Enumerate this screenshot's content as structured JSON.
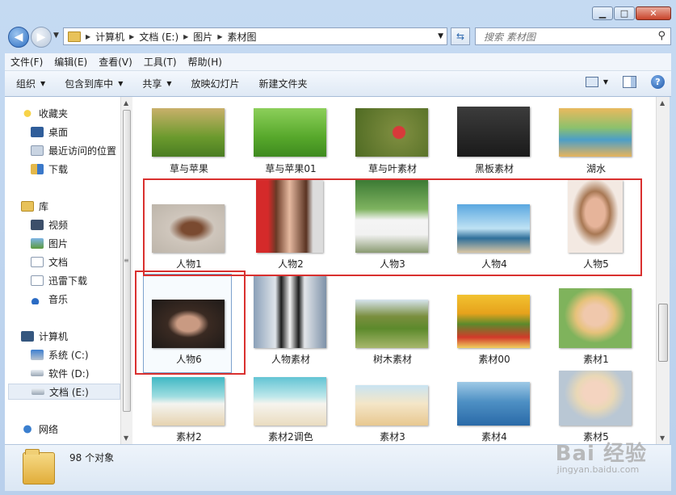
{
  "address": {
    "segments": [
      "计算机",
      "文档 (E:)",
      "图片",
      "素材图"
    ]
  },
  "search": {
    "placeholder": "搜索 素材图"
  },
  "menu": [
    "文件(F)",
    "编辑(E)",
    "查看(V)",
    "工具(T)",
    "帮助(H)"
  ],
  "commands": {
    "organize": "组织",
    "include": "包含到库中",
    "share": "共享",
    "slideshow": "放映幻灯片",
    "newfolder": "新建文件夹"
  },
  "nav": {
    "favorites": "收藏夹",
    "desktop": "桌面",
    "recent": "最近访问的位置",
    "downloads": "下载",
    "library": "库",
    "videos": "视频",
    "pictures": "图片",
    "documents": "文档",
    "xunlei": "迅雷下载",
    "music": "音乐",
    "computer": "计算机",
    "drive_c": "系统 (C:)",
    "drive_d": "软件 (D:)",
    "drive_e": "文档 (E:)",
    "network": "网络"
  },
  "files": [
    {
      "name": "草与苹果"
    },
    {
      "name": "草与苹果01"
    },
    {
      "name": "草与叶素材"
    },
    {
      "name": "黑板素材"
    },
    {
      "name": "湖水"
    },
    {
      "name": "人物1"
    },
    {
      "name": "人物2"
    },
    {
      "name": "人物3"
    },
    {
      "name": "人物4"
    },
    {
      "name": "人物5"
    },
    {
      "name": "人物6"
    },
    {
      "name": "人物素材"
    },
    {
      "name": "树木素材"
    },
    {
      "name": "素材00"
    },
    {
      "name": "素材1"
    },
    {
      "name": "素材2"
    },
    {
      "name": "素材2调色"
    },
    {
      "name": "素材3"
    },
    {
      "name": "素材4"
    },
    {
      "name": "素材5"
    }
  ],
  "status": {
    "count": "98 个对象"
  },
  "watermark": {
    "main": "Bai 经验",
    "url": "jingyan.baidu.com"
  },
  "colors": {
    "highlight": "#d9302f",
    "accent": "#2d6fc2"
  }
}
